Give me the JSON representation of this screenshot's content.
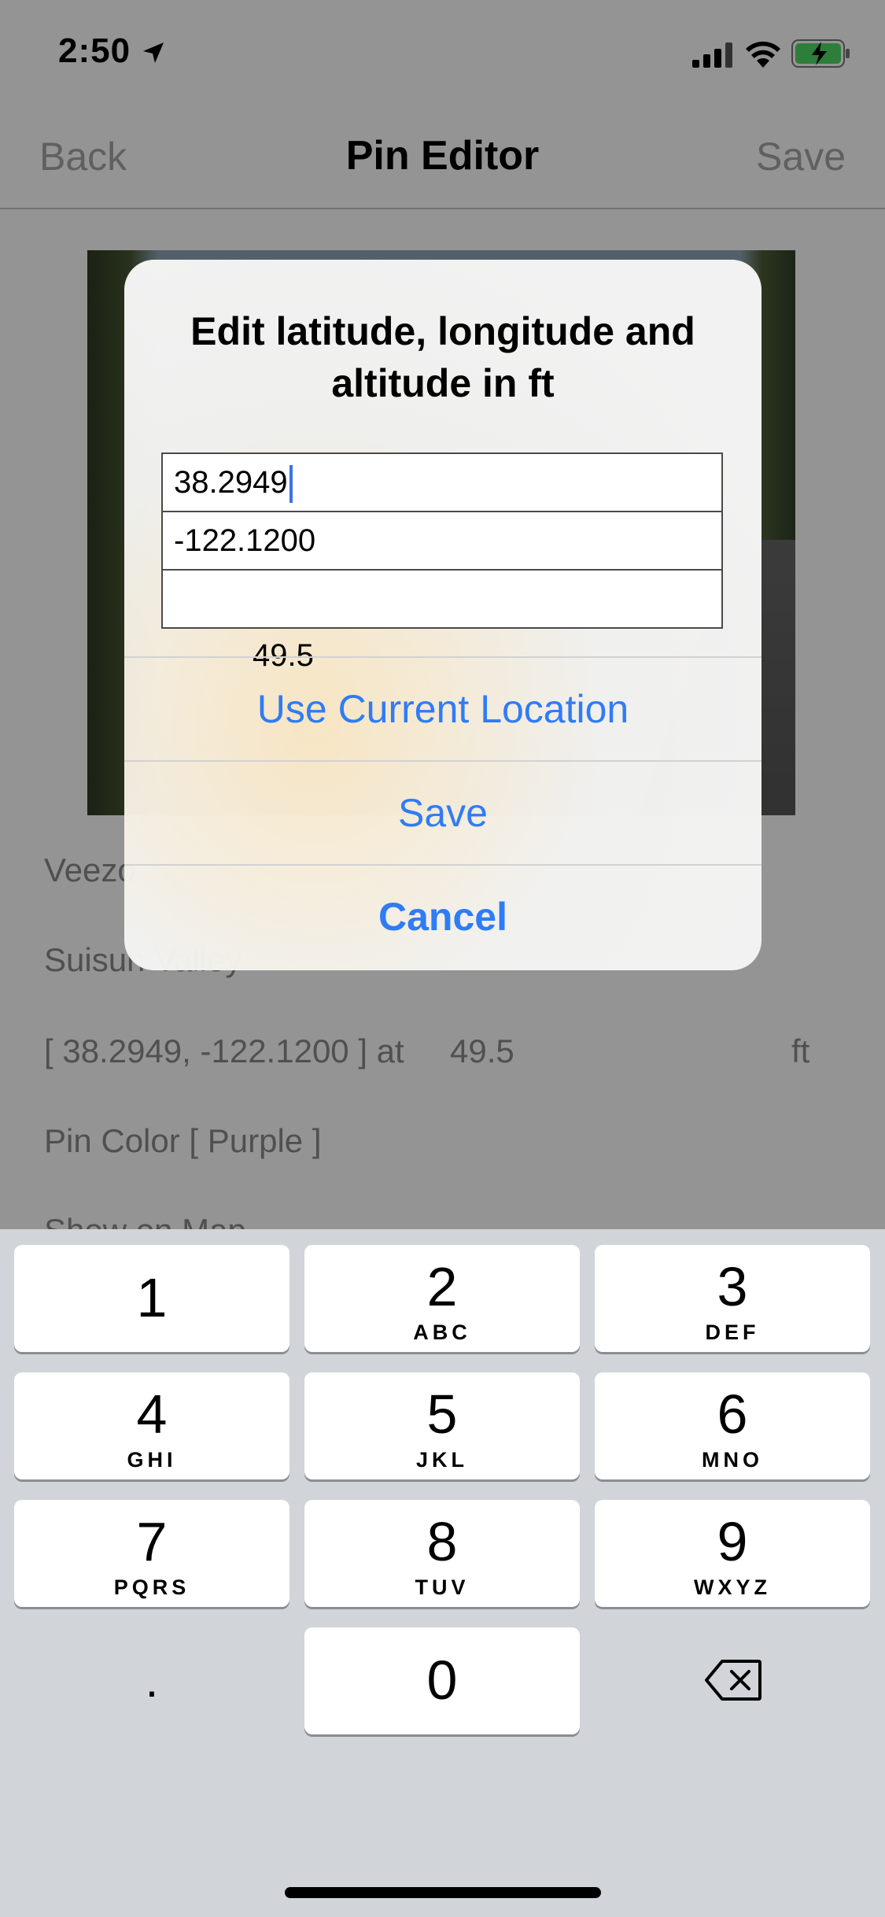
{
  "status_bar": {
    "time": "2:50",
    "icons": [
      "location-arrow-icon",
      "signal-icon",
      "wifi-icon",
      "battery-charging-icon"
    ]
  },
  "nav": {
    "back_label": "Back",
    "title": "Pin Editor",
    "save_label": "Save"
  },
  "details": {
    "name_partial": "Veezo",
    "region_partial": "Suisun Valley",
    "coords_text": "[ 38.2949, -122.1200 ] at     49.5",
    "unit": "ft",
    "pin_color": "Pin Color [ Purple ]",
    "show_on_map_partial": "Show on Map"
  },
  "alert": {
    "title": "Edit latitude, longitude and altitude in ft",
    "fields": {
      "latitude": "38.2949",
      "longitude": "-122.1200",
      "altitude": "   49.5"
    },
    "buttons": {
      "use_current_location": "Use Current Location",
      "save": "Save",
      "cancel": "Cancel"
    }
  },
  "keyboard": {
    "keys": [
      {
        "digit": "1",
        "letters": ""
      },
      {
        "digit": "2",
        "letters": "ABC"
      },
      {
        "digit": "3",
        "letters": "DEF"
      },
      {
        "digit": "4",
        "letters": "GHI"
      },
      {
        "digit": "5",
        "letters": "JKL"
      },
      {
        "digit": "6",
        "letters": "MNO"
      },
      {
        "digit": "7",
        "letters": "PQRS"
      },
      {
        "digit": "8",
        "letters": "TUV"
      },
      {
        "digit": "9",
        "letters": "WXYZ"
      },
      {
        "digit": "0",
        "letters": ""
      }
    ],
    "decimal": ".",
    "delete_icon": "delete-backspace-icon"
  },
  "colors": {
    "accent": "#2f7cf6",
    "keyboard_bg": "#d1d4d9",
    "caret": "#3b74e4"
  }
}
